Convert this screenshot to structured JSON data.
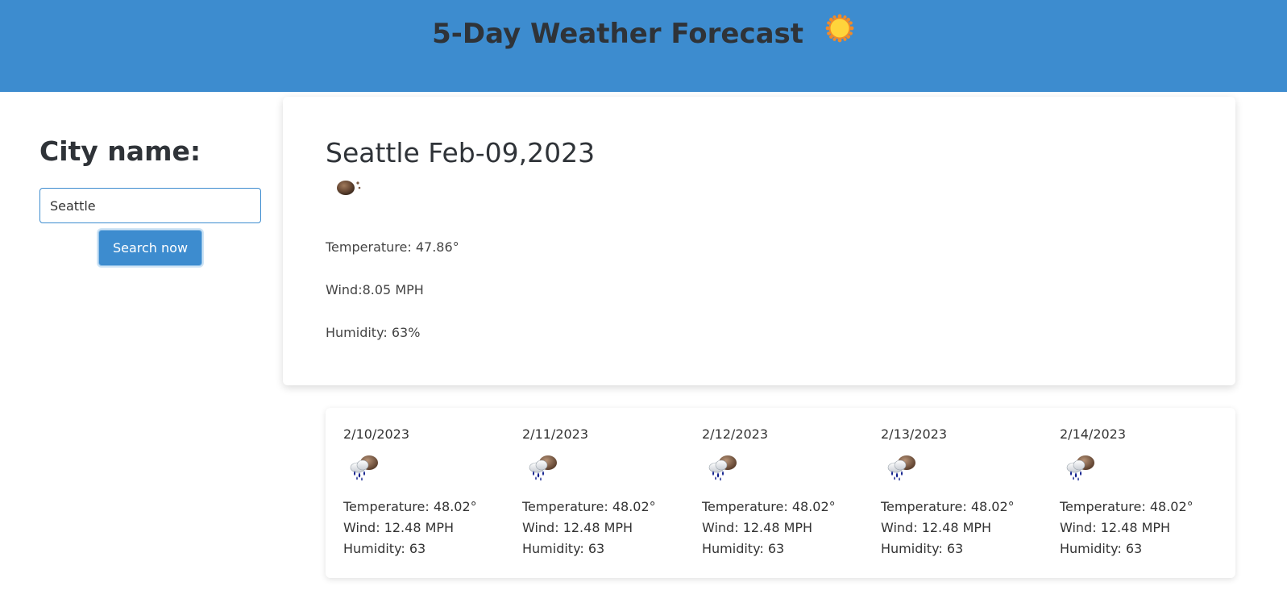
{
  "header": {
    "title": "5-Day Weather Forecast",
    "icon": "sun-icon"
  },
  "sidebar": {
    "heading": "City name:",
    "search": {
      "value": "Seattle",
      "placeholder": ""
    },
    "search_button_label": "Search now"
  },
  "current": {
    "title": "Seattle Feb-09,2023",
    "icon": "weather-icon",
    "temperature": "Temperature: 47.86°",
    "wind": "Wind:8.05 MPH",
    "humidity": "Humidity: 63%"
  },
  "forecast": [
    {
      "date": "2/10/2023",
      "icon": "rain-cloud-icon",
      "temperature": "Temperature: 48.02°",
      "wind": "Wind: 12.48 MPH",
      "humidity": "Humidity: 63"
    },
    {
      "date": "2/11/2023",
      "icon": "rain-cloud-icon",
      "temperature": "Temperature: 48.02°",
      "wind": "Wind: 12.48 MPH",
      "humidity": "Humidity: 63"
    },
    {
      "date": "2/12/2023",
      "icon": "rain-cloud-icon",
      "temperature": "Temperature: 48.02°",
      "wind": "Wind: 12.48 MPH",
      "humidity": "Humidity: 63"
    },
    {
      "date": "2/13/2023",
      "icon": "rain-cloud-icon",
      "temperature": "Temperature: 48.02°",
      "wind": "Wind: 12.48 MPH",
      "humidity": "Humidity: 63"
    },
    {
      "date": "2/14/2023",
      "icon": "rain-cloud-icon",
      "temperature": "Temperature: 48.02°",
      "wind": "Wind: 12.48 MPH",
      "humidity": "Humidity: 63"
    }
  ],
  "colors": {
    "accent": "#3d8ccf",
    "header_text": "#2f3338"
  }
}
